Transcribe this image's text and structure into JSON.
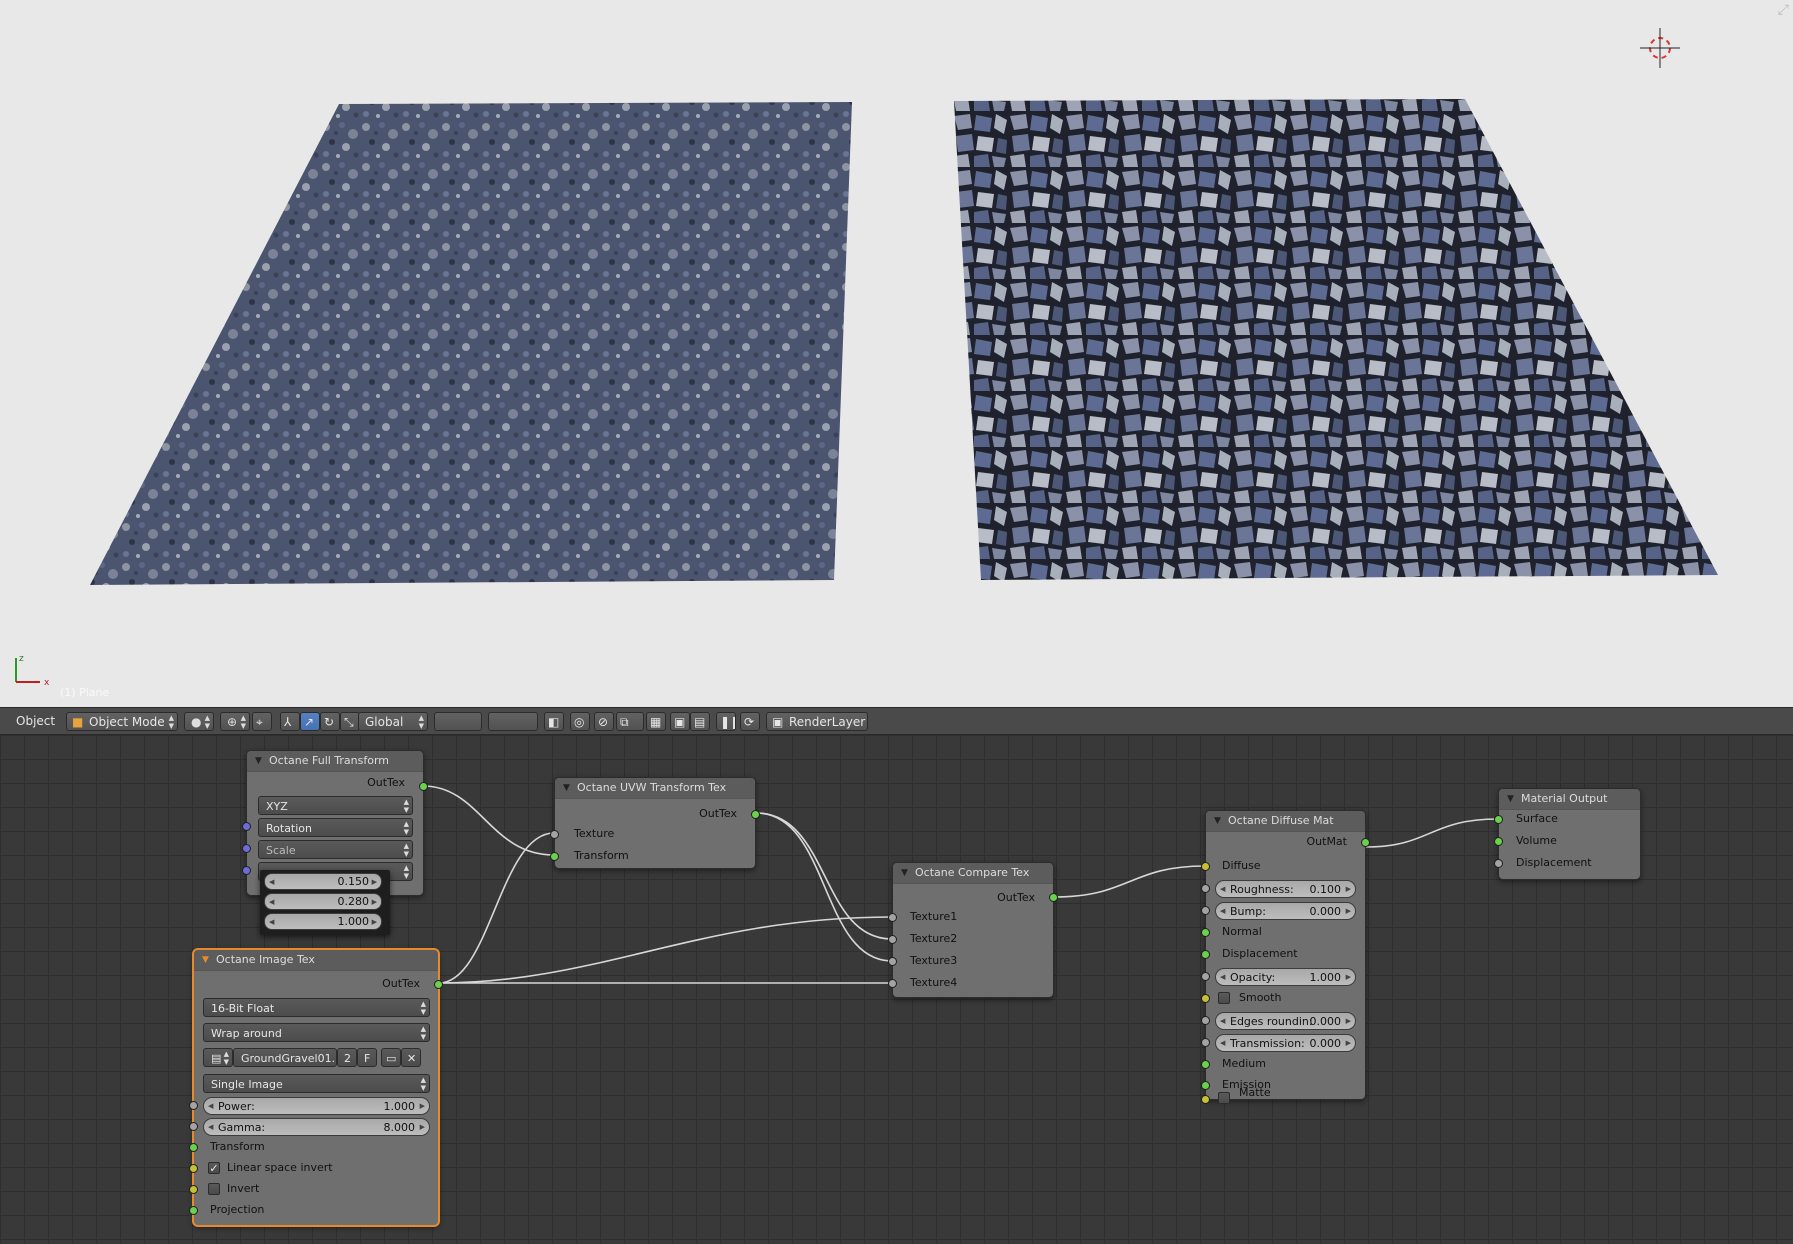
{
  "viewport": {
    "object_label": "(1) Plane",
    "axis_x": "x",
    "axis_z": "z"
  },
  "header": {
    "menu_object": "Object",
    "mode": "Object Mode",
    "orientation": "Global",
    "render_layer": "RenderLayer"
  },
  "nodes": {
    "full_transform": {
      "title": "Octane Full Transform",
      "out": "OutTex",
      "order": "XYZ",
      "rotation": "Rotation",
      "scale": "Scale",
      "scale_values": [
        "0.150",
        "0.280",
        "1.000"
      ]
    },
    "uvw": {
      "title": "Octane UVW Transform Tex",
      "out": "OutTex",
      "texture": "Texture",
      "transform": "Transform"
    },
    "image": {
      "title": "Octane Image Tex",
      "out": "OutTex",
      "bit_depth": "16-Bit Float",
      "wrap": "Wrap around",
      "file_name": "GroundGravel01...",
      "users": "2",
      "fake": "F",
      "source": "Single Image",
      "power_label": "Power:",
      "power_value": "1.000",
      "gamma_label": "Gamma:",
      "gamma_value": "8.000",
      "transform": "Transform",
      "linear_invert": "Linear space invert",
      "invert": "Invert",
      "projection": "Projection"
    },
    "compare": {
      "title": "Octane Compare Tex",
      "out": "OutTex",
      "inputs": [
        "Texture1",
        "Texture2",
        "Texture3",
        "Texture4"
      ]
    },
    "diffuse": {
      "title": "Octane Diffuse Mat",
      "out": "OutMat",
      "diffuse": "Diffuse",
      "roughness_label": "Roughness:",
      "roughness_value": "0.100",
      "bump_label": "Bump:",
      "bump_value": "0.000",
      "normal": "Normal",
      "displacement": "Displacement",
      "opacity_label": "Opacity:",
      "opacity_value": "1.000",
      "smooth": "Smooth",
      "edges_label": "Edges roundin:",
      "edges_value": "0.000",
      "transmission_label": "Transmission:",
      "transmission_value": "0.000",
      "medium": "Medium",
      "emission": "Emission",
      "matte": "Matte"
    },
    "output": {
      "title": "Material Output",
      "surface": "Surface",
      "volume": "Volume",
      "displacement": "Displacement"
    }
  },
  "colors": {
    "socket_green": "#6ad14a",
    "socket_yellow": "#c7c035",
    "socket_grey": "#a3a3a3",
    "socket_purple": "#6b6bd9",
    "selected_outline": "#e68a2c"
  }
}
